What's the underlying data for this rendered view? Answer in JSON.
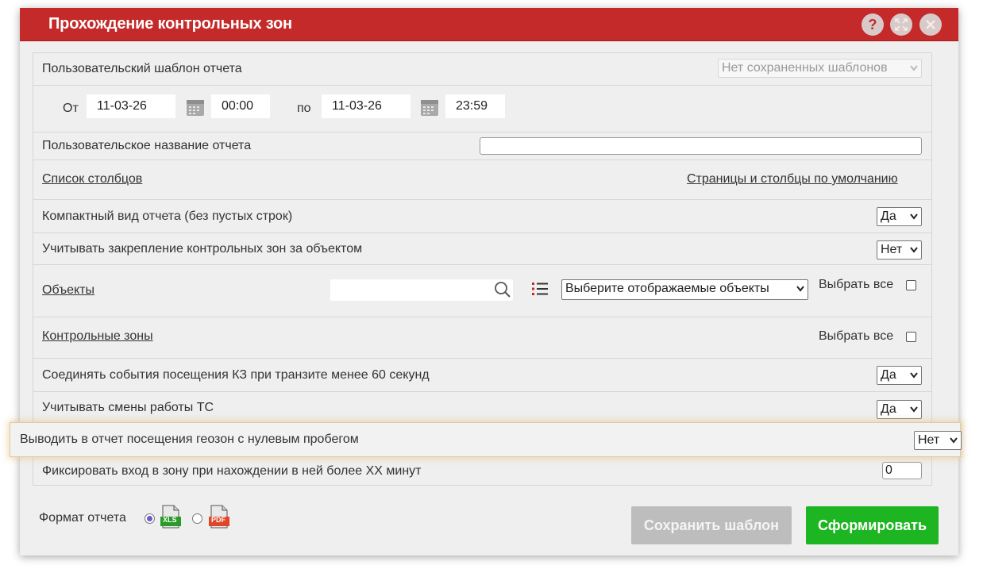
{
  "dialog": {
    "title": "Прохождение контрольных зон",
    "help_icon": "?",
    "maximize_icon": "expand-icon",
    "close_icon": "close-icon"
  },
  "template": {
    "label": "Пользовательский шаблон отчета",
    "select_value": "Нет сохраненных шаблонов"
  },
  "period": {
    "from_label": "От",
    "from_date": "11-03-26",
    "from_time": "00:00",
    "to_label": "по",
    "to_date": "11-03-26",
    "to_time": "23:59"
  },
  "report_name": {
    "label": "Пользовательское название отчета",
    "value": ""
  },
  "columns": {
    "list_label": "Список столбцов",
    "defaults_label": "Страницы и столбцы по умолчанию"
  },
  "compact": {
    "label": "Компактный вид отчета (без пустых строк)",
    "value": "Да"
  },
  "binding": {
    "label": "Учитывать закрепление контрольных зон за объектом",
    "value": "Нет"
  },
  "objects": {
    "label": "Объекты",
    "search_value": "",
    "select_value": "Выберите отображаемые объекты",
    "select_all_label": "Выбрать все"
  },
  "zones": {
    "label": "Контрольные зоны",
    "select_all_label": "Выбрать все"
  },
  "merge_events": {
    "label": "Соединять события посещения КЗ при транзите менее 60 секунд",
    "value": "Да"
  },
  "shifts": {
    "label": "Учитывать смены работы ТС",
    "value": "Да"
  },
  "zero_mileage": {
    "label": "Выводить в отчет посещения геозон с нулевым пробегом",
    "value": "Нет"
  },
  "entry_minutes": {
    "label": "Фиксировать вход в зону при нахождении в ней более ХХ минут",
    "value": "0"
  },
  "footer": {
    "format_label": "Формат отчета",
    "xls_label": "XLS",
    "pdf_label": "PDF",
    "save_template_label": "Сохранить шаблон",
    "generate_label": "Сформировать"
  },
  "colors": {
    "title_bar": "#c42a2a",
    "generate_button": "#1db522",
    "save_button_disabled": "#bdbdbd"
  }
}
